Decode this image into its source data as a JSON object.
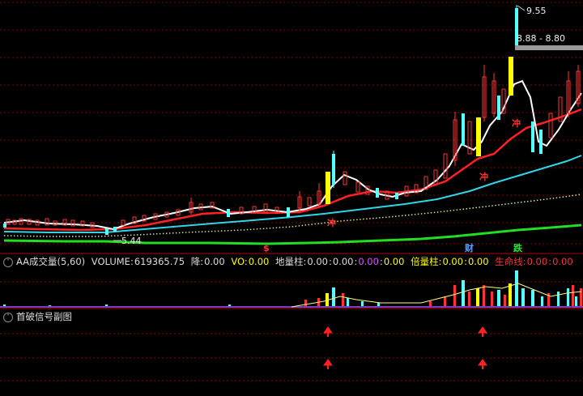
{
  "price_labels": {
    "high": "9.55",
    "range": "8.88 - 8.80",
    "low": "5.44"
  },
  "markers": {
    "chong": "冲",
    "cai": "财",
    "die": "跌",
    "dollar": "$"
  },
  "volume_panel": {
    "title": "AA成交量(5,60)",
    "volume_label": "VOLUME:",
    "volume_value": "619365.75",
    "jiang_label": "降:",
    "jiang_value": "0.00",
    "vo_label": "VO:",
    "vo_value": "0.00",
    "diliang_label": "地量柱:",
    "diliang_v1": "0.00",
    "diliang_v2": "0.00",
    "diliang_v3": "0.00",
    "diliang_v4": "0.00",
    "beiliang_label": "倍量柱:",
    "beiliang_v1": "0.00",
    "beiliang_v2": "0.00",
    "shengming_label": "生命线:",
    "shengming_v1": "0.00",
    "shengming_v2": "0.00"
  },
  "signal_panel": {
    "title": "首破信号副图"
  },
  "colors": {
    "up": "#ff3333",
    "down": "#54ffff",
    "ma5": "#ffffff",
    "ma10": "#ffff00",
    "ma20": "#ff2020",
    "ma60": "#2fd6e6",
    "ma120": "#ffff80",
    "ma250": "#22dd22",
    "grid": "#7a0000"
  }
}
